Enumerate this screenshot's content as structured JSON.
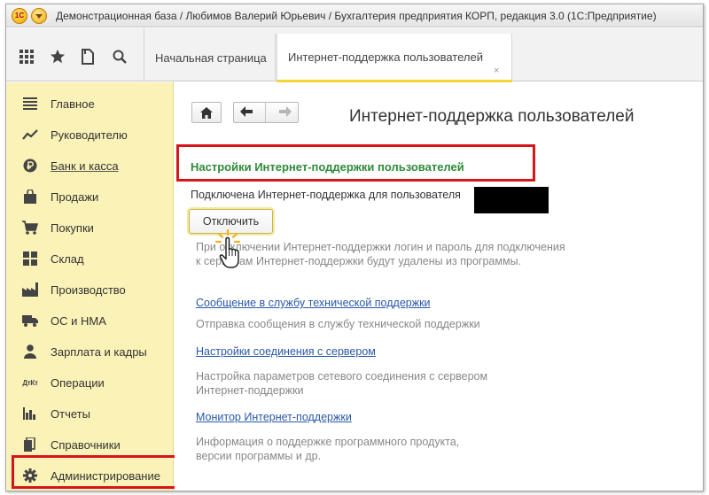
{
  "window": {
    "title": "Демонстрационная база / Любимов Валерий Юрьевич / Бухгалтерия предприятия КОРП, редакция 3.0  (1С:Предприятие)",
    "logo_text": "1С"
  },
  "tabs": {
    "home": "Начальная страница",
    "active": "Интернет-поддержка пользователей",
    "close": "×"
  },
  "sidebar": {
    "items": [
      {
        "label": "Главное",
        "icon": "menu-lines-icon"
      },
      {
        "label": "Руководителю",
        "icon": "trend-chart-icon"
      },
      {
        "label": "Банк и касса",
        "icon": "ruble-coin-icon"
      },
      {
        "label": "Продажи",
        "icon": "shopping-bag-icon"
      },
      {
        "label": "Покупки",
        "icon": "shopping-cart-icon"
      },
      {
        "label": "Склад",
        "icon": "warehouse-icon"
      },
      {
        "label": "Производство",
        "icon": "factory-icon"
      },
      {
        "label": "ОС и НМА",
        "icon": "truck-icon"
      },
      {
        "label": "Зарплата и кадры",
        "icon": "person-icon"
      },
      {
        "label": "Операции",
        "icon": "debit-credit-icon"
      },
      {
        "label": "Отчеты",
        "icon": "bar-chart-icon"
      },
      {
        "label": "Справочники",
        "icon": "books-icon"
      },
      {
        "label": "Администрирование",
        "icon": "gear-icon"
      }
    ],
    "debit_credit_text": "ДтКт"
  },
  "content": {
    "page_title": "Интернет-поддержка пользователей",
    "section_title": "Настройки Интернет-поддержки пользователей",
    "connected_text": "Подключена Интернет-поддержка для пользователя",
    "disconnect_label": "Отключить",
    "disconnect_note_1": "При отключении Интернет-поддержки логин и пароль для подключения",
    "disconnect_note_2": "к сервисам Интернет-поддержки будут удалены из программы.",
    "links": [
      {
        "label": "Сообщение в службу технической поддержки",
        "desc": [
          "Отправка сообщения в службу технической поддержки"
        ]
      },
      {
        "label": "Настройки соединения с сервером",
        "desc": [
          "Настройка параметров сетевого соединения с сервером",
          "Интернет-поддержки"
        ]
      },
      {
        "label": "Монитор Интернет-поддержки",
        "desc": [
          "Информация о поддержке программного продукта,",
          "версии программы и др."
        ]
      }
    ]
  },
  "colors": {
    "sidebar_bg": "#fbf2b8",
    "highlight_red": "#d6151b",
    "section_green": "#2f8a3a",
    "link_blue": "#2a58a8",
    "active_tab_accent": "#f5d433"
  }
}
